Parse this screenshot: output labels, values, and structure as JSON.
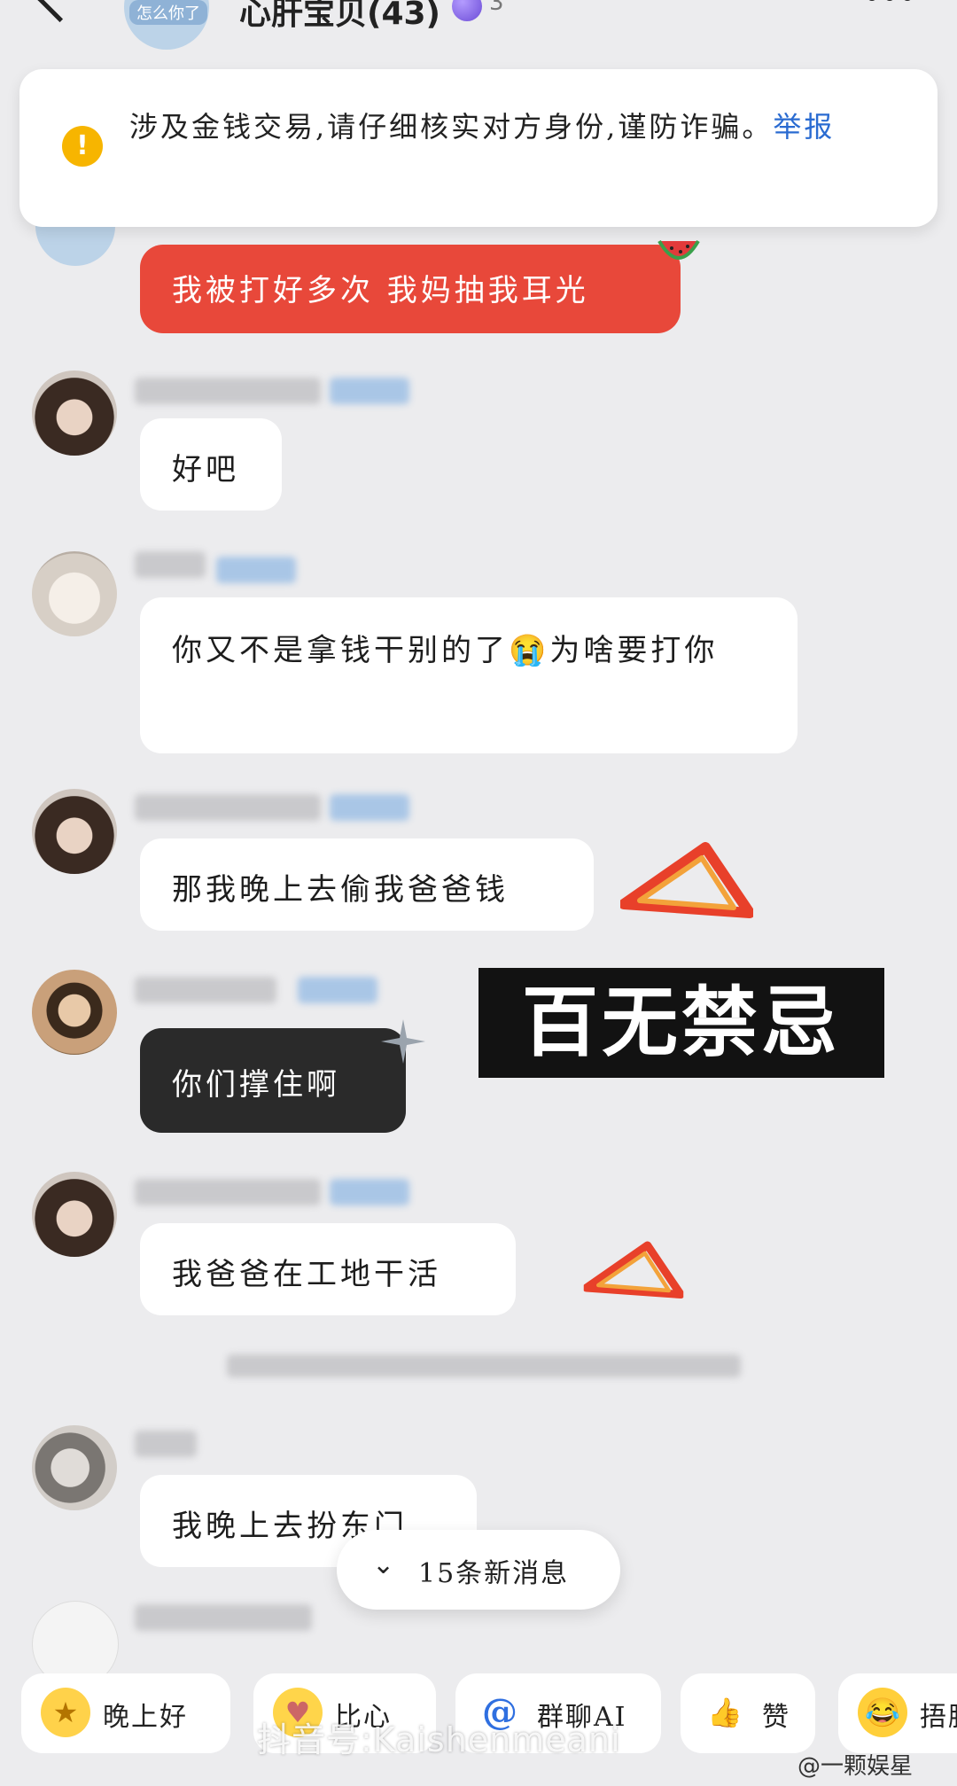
{
  "header": {
    "title": "心肝宝贝(43)",
    "avatar_tag": "怎么你了",
    "badge_count": "3"
  },
  "banner": {
    "text": "涉及金钱交易,请仔细核实对方身份,谨防诈骗。",
    "link": "举报"
  },
  "messages": [
    {
      "text": "我被打好多次 我妈抽我耳光"
    },
    {
      "text": "好吧"
    },
    {
      "text": "你又不是拿钱干别的了😭为啥要打你"
    },
    {
      "text": "那我晚上去偷我爸爸钱"
    },
    {
      "text": "你们撑住啊"
    },
    {
      "text": "我爸爸在工地干活"
    },
    {
      "text": "我晚上去扮东门"
    }
  ],
  "callout": {
    "text": "百无禁忌"
  },
  "new_messages": {
    "text": "15条新消息"
  },
  "quick_replies": [
    {
      "icon": "star-face-icon",
      "label": "晚上好"
    },
    {
      "icon": "chick-icon",
      "label": "比心"
    },
    {
      "icon": "at-icon",
      "label": "群聊AI"
    },
    {
      "icon": "thumbs-up-icon",
      "label": "赞"
    },
    {
      "icon": "laugh-cry-icon",
      "label": "捂脸"
    }
  ],
  "watermark": {
    "text": "抖音号:Kaishenmeani",
    "source": "@一颗娱星"
  }
}
